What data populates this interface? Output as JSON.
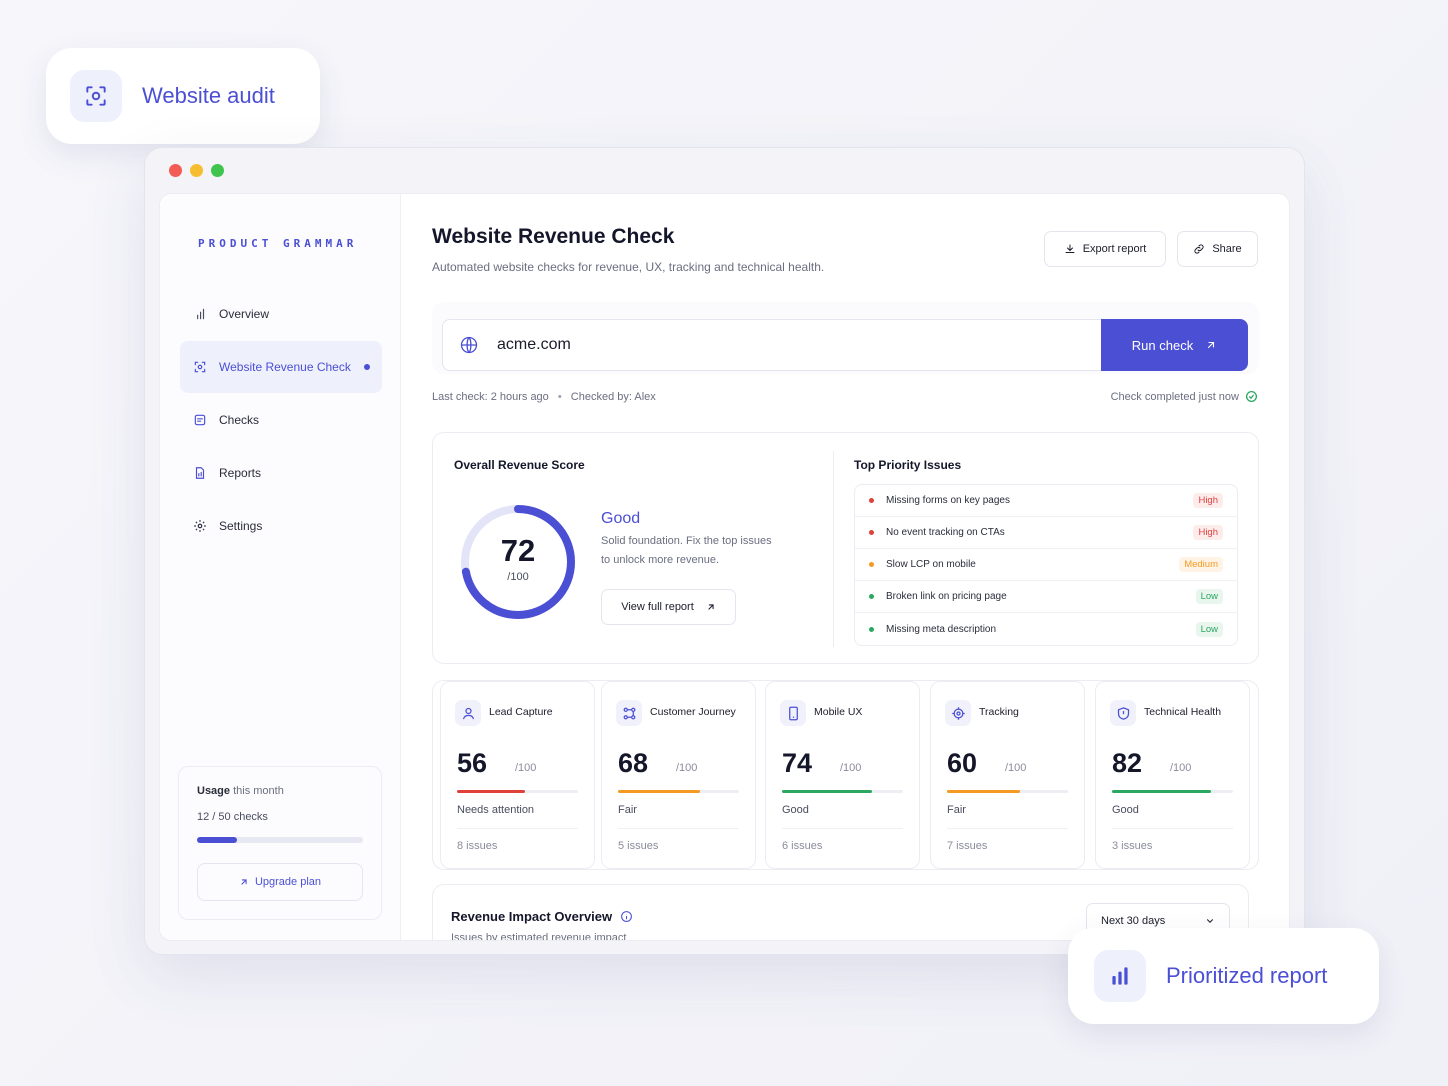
{
  "badges": {
    "audit": "Website audit",
    "report": "Prioritized report"
  },
  "colors": {
    "accent": "#4b4fd4",
    "high": "#e0413a",
    "medium": "#f59a23",
    "low": "#2aa860"
  },
  "sidebar": {
    "brand": "PRODUCT GRAMMAR",
    "items": [
      {
        "label": "Overview",
        "icon": "overview-icon"
      },
      {
        "label": "Website Revenue Check",
        "icon": "scan-icon",
        "active": true
      },
      {
        "label": "Checks",
        "icon": "checklist-icon"
      },
      {
        "label": "Reports",
        "icon": "report-icon"
      },
      {
        "label": "Settings",
        "icon": "gear-icon"
      }
    ],
    "usage": {
      "title": "Usage",
      "period": "this month",
      "count": "12 / 50 checks",
      "used": 12,
      "total": 50,
      "upgrade_label": "Upgrade plan"
    }
  },
  "header": {
    "title": "Website Revenue Check",
    "subtitle": "Automated website checks for revenue, UX, tracking and technical health.",
    "export_label": "Export report",
    "share_label": "Share"
  },
  "check": {
    "url": "acme.com",
    "run_label": "Run check",
    "last_check": "Last check: 2 hours ago",
    "separator": "•",
    "checked_by": "Checked by: Alex",
    "status": "Check completed just now"
  },
  "score": {
    "heading": "Overall Revenue Score",
    "value": "72",
    "value_num": 72,
    "denominator": "/100",
    "rating": "Good",
    "description": "Solid foundation. Fix the top issues to unlock more revenue.",
    "view_label": "View full report"
  },
  "priority": {
    "heading": "Top Priority Issues",
    "issues": [
      {
        "label": "Missing forms on key pages",
        "severity": "High"
      },
      {
        "label": "No event tracking on CTAs",
        "severity": "High"
      },
      {
        "label": "Slow LCP on mobile",
        "severity": "Medium"
      },
      {
        "label": "Broken link on pricing page",
        "severity": "Low"
      },
      {
        "label": "Missing meta description",
        "severity": "Low"
      }
    ]
  },
  "metrics": [
    {
      "title": "Lead Capture",
      "icon": "user-icon",
      "score": "56",
      "score_num": 56,
      "den": "/100",
      "status": "Needs attention",
      "issues": "8 issues",
      "color": "#e0413a"
    },
    {
      "title": "Customer Journey",
      "icon": "journey-icon",
      "score": "68",
      "score_num": 68,
      "den": "/100",
      "status": "Fair",
      "issues": "5 issues",
      "color": "#f59a23"
    },
    {
      "title": "Mobile UX",
      "icon": "mobile-icon",
      "score": "74",
      "score_num": 74,
      "den": "/100",
      "status": "Good",
      "issues": "6 issues",
      "color": "#2aa860"
    },
    {
      "title": "Tracking",
      "icon": "target-icon",
      "score": "60",
      "score_num": 60,
      "den": "/100",
      "status": "Fair",
      "issues": "7 issues",
      "color": "#f59a23"
    },
    {
      "title": "Technical Health",
      "icon": "shield-icon",
      "score": "82",
      "score_num": 82,
      "den": "/100",
      "status": "Good",
      "issues": "3 issues",
      "color": "#2aa860"
    }
  ],
  "impact": {
    "title": "Revenue Impact Overview",
    "subtitle": "Issues by estimated revenue impact",
    "range": "Next 30 days"
  }
}
